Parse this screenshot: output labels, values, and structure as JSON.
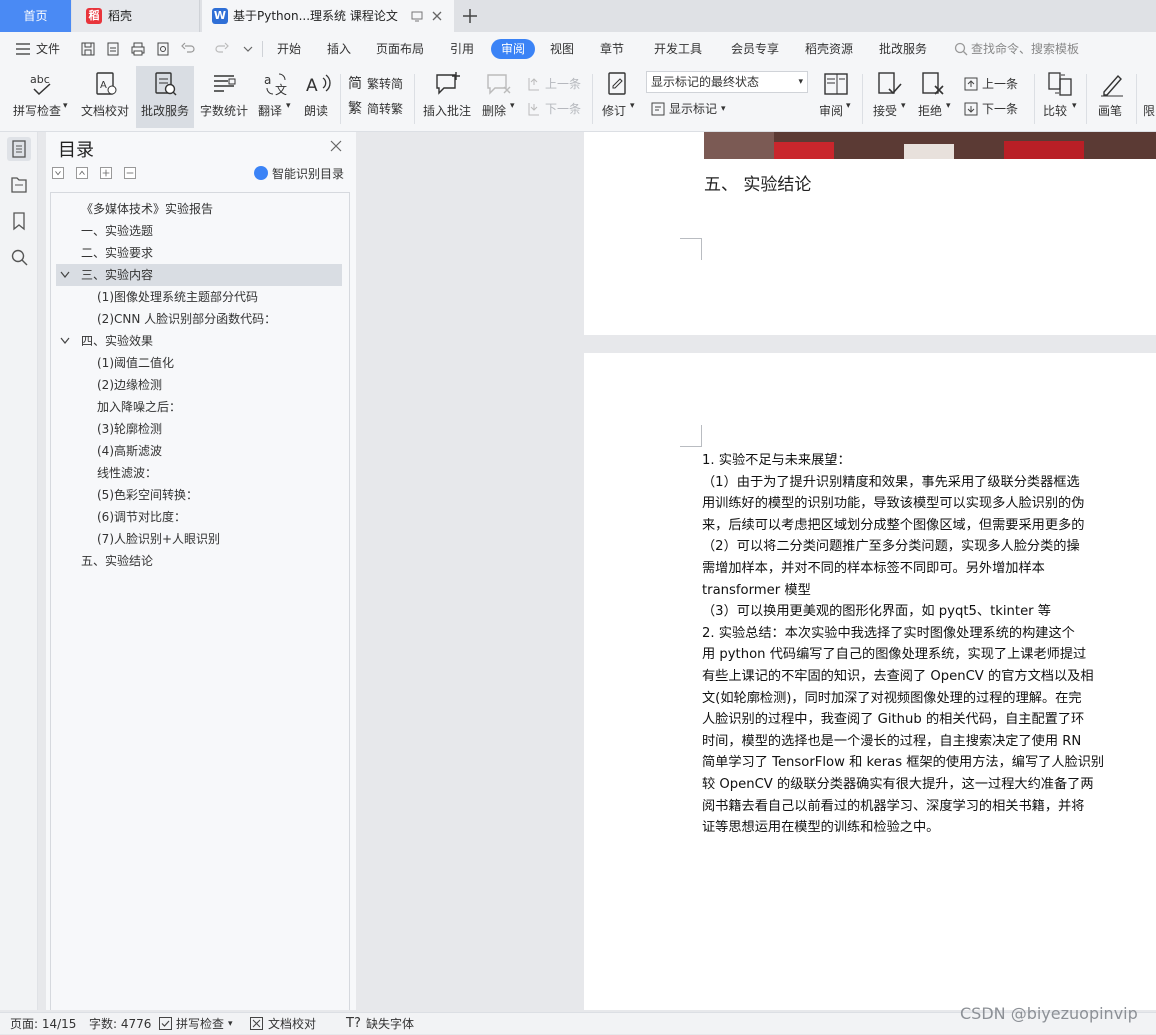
{
  "tabs": {
    "home": "首页",
    "daoke": "稻壳",
    "doc": "基于Python...理系统 课程论文"
  },
  "menu": {
    "file": "文件",
    "items": [
      "开始",
      "插入",
      "页面布局",
      "引用",
      "审阅",
      "视图",
      "章节",
      "开发工具",
      "会员专享",
      "稻壳资源",
      "批改服务"
    ],
    "active": "审阅",
    "search_placeholder": "查找命令、搜索模板"
  },
  "toolbar": {
    "spellcheck": "拼写检查",
    "doccheck": "文档校对",
    "review_service": "批改服务",
    "wordcount": "字数统计",
    "translate": "翻译",
    "read": "朗读",
    "trad": "繁转简",
    "simp": "简转繁",
    "insert_comment": "插入批注",
    "delete": "删除",
    "prev": "上一条",
    "next": "下一条",
    "revise": "修订",
    "mark_state": "显示标记的最终状态",
    "show_marks": "显示标记",
    "review": "审阅",
    "accept": "接受",
    "reject": "拒绝",
    "prev2": "上一条",
    "next2": "下一条",
    "compare": "比较",
    "pen": "画笔",
    "limit": "限"
  },
  "nav": {
    "title": "目录",
    "smart": "智能识别目录",
    "items": [
      "《多媒体技术》实验报告",
      "一、实验选题",
      "二、实验要求",
      "三、实验内容",
      "(1)图像处理系统主题部分代码",
      "(2)CNN 人脸识别部分函数代码：",
      "四、实验效果",
      "(1)阈值二值化",
      "(2)边缘检测",
      "加入降噪之后：",
      "(3)轮廓检测",
      "(4)高斯滤波",
      "线性滤波：",
      "(5)色彩空间转换：",
      "(6)调节对比度：",
      "(7)人脸识别+人眼识别",
      "五、实验结论"
    ]
  },
  "doc": {
    "heading": "五、    实验结论",
    "lines": [
      "1. 实验不足与未来展望：",
      "（1）由于为了提升识别精度和效果，事先采用了级联分类器框选",
      "用训练好的模型的识别功能，导致该模型可以实现多人脸识别的伪",
      "来，后续可以考虑把区域划分成整个图像区域，但需要采用更多的",
      "（2）可以将二分类问题推广至多分类问题，实现多人脸分类的操",
      "需增加样本，并对不同的样本标签不同即可。另外增加样本",
      "transformer 模型",
      "（3）可以换用更美观的图形化界面，如 pyqt5、tkinter 等",
      "2. 实验总结：本次实验中我选择了实时图像处理系统的构建这个",
      "用 python 代码编写了自己的图像处理系统，实现了上课老师提过",
      "有些上课记的不牢固的知识，去查阅了 OpenCV 的官方文档以及相",
      "文(如轮廓检测)，同时加深了对视频图像处理的过程的理解。在完",
      "人脸识别的过程中，我查阅了 Github 的相关代码，自主配置了环",
      "时间，模型的选择也是一个漫长的过程，自主搜索决定了使用 RN",
      "简单学习了 TensorFlow 和 keras 框架的使用方法，编写了人脸识别",
      "较 OpenCV 的级联分类器确实有很大提升，这一过程大约准备了两",
      "阅书籍去看自己以前看过的机器学习、深度学习的相关书籍，并将",
      "证等思想运用在模型的训练和检验之中。"
    ]
  },
  "status": {
    "page": "页面: 14/15",
    "words": "字数: 4776",
    "spell": "拼写检查",
    "doccheck": "文档校对",
    "missing_font": "缺失字体"
  },
  "watermark": "CSDN @biyezuopinvip",
  "colors": {
    "accent": "#3b83f6",
    "home_tab": "#4a8af4",
    "daoke": "#e8343b"
  }
}
